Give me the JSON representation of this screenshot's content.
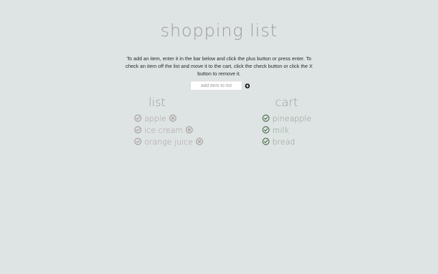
{
  "page": {
    "title": "shopping list",
    "instructions": "To add an item, enter it in the bar below and click the plus button or press enter. To check an item off the list and move it to the cart, click the check button or click the X button to remove it."
  },
  "add_item": {
    "placeholder": "add item to list",
    "add_icon": "plus-circle-icon"
  },
  "list": {
    "header": "list",
    "items": [
      {
        "label": "apple",
        "check_icon": "check-circle-icon",
        "remove_icon": "x-circle-icon"
      },
      {
        "label": "ice cream",
        "check_icon": "check-circle-icon",
        "remove_icon": "x-circle-icon"
      },
      {
        "label": "orange juice",
        "check_icon": "check-circle-icon",
        "remove_icon": "x-circle-icon"
      }
    ]
  },
  "cart": {
    "header": "cart",
    "items": [
      {
        "label": "pineapple",
        "check_icon": "check-circle-icon"
      },
      {
        "label": "milk",
        "check_icon": "check-circle-icon"
      },
      {
        "label": "bread",
        "check_icon": "check-circle-icon"
      }
    ]
  },
  "colors": {
    "background": "#dde4e3",
    "list_icon": "#a89c9c",
    "cart_icon": "#4e6b4e",
    "title": "#a09a9a"
  }
}
